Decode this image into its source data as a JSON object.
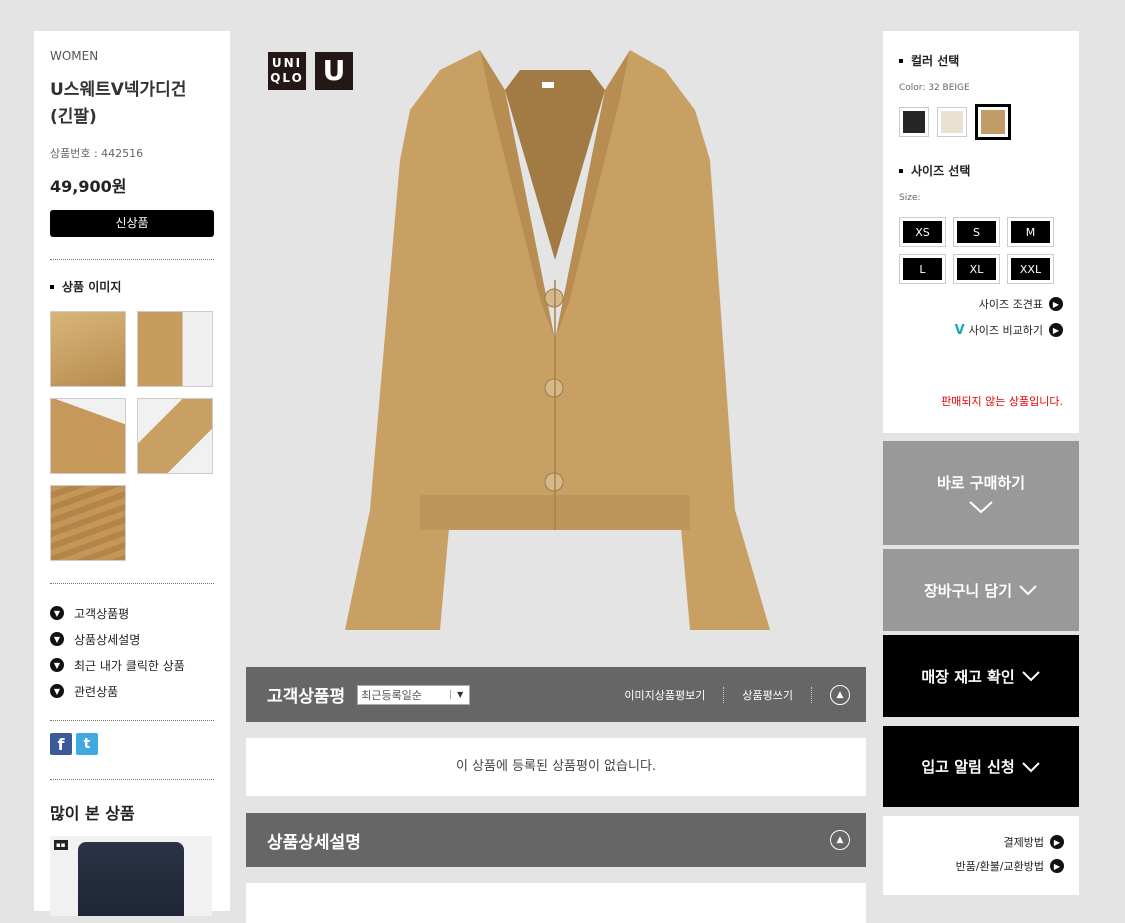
{
  "left": {
    "category": "WOMEN",
    "product_name_line1": "U스웨트V넥가디건",
    "product_name_line2": "(긴팔)",
    "product_number": "상품번호 : 442516",
    "price": "49,900원",
    "new_badge": "신상품",
    "image_section_title": "상품 이미지",
    "links": [
      "고객상품평",
      "상품상세설명",
      "최근 내가 클릭한 상품",
      "관련상품"
    ],
    "popular_title": "많이 본 상품"
  },
  "center": {
    "logo_uniqlo_1": "UNI",
    "logo_uniqlo_2": "QLO",
    "logo_u": "U",
    "review_title": "고객상품평",
    "sort_value": "최근등록일순",
    "image_reviews_link": "이미지상품평보기",
    "write_review_link": "상품평쓰기",
    "empty_review_text": "이 상품에 등록된 상품평이 없습니다.",
    "detail_title": "상품상세설명"
  },
  "right": {
    "color_title": "컬러 선택",
    "color_label": "Color: 32 BEIGE",
    "colors": [
      "#262626",
      "#e9e1d1",
      "#c29c66"
    ],
    "size_title": "사이즈 선택",
    "size_label": "Size:",
    "sizes": [
      "XS",
      "S",
      "M",
      "L",
      "XL",
      "XXL"
    ],
    "size_chart_link": "사이즈 조견표",
    "size_compare_link": "사이즈 비교하기",
    "unavailable_text": "판매되지 않는 상품입니다.",
    "buy_now": "바로 구매하기",
    "add_cart": "장바구니 담기",
    "store_stock": "매장 재고 확인",
    "restock_alert": "입고 알림 신청",
    "payment_link": "결제방법",
    "return_link": "반품/환불/교환방법"
  }
}
